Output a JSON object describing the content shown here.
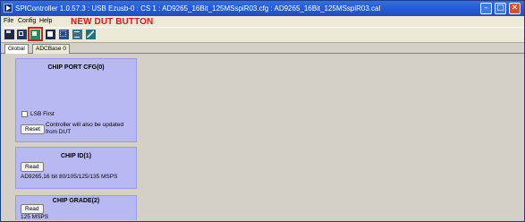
{
  "window": {
    "title": "SPIController 1.0.57.3 : USB Ezusb-0 : CS 1 : AD9265_16Bit_125MSspiR03.cfg : AD9265_16Bit_125MSspiR03.cal",
    "minimize_glyph": "–",
    "maximize_glyph": "□",
    "close_glyph": "✕"
  },
  "menu": {
    "items": [
      {
        "label": "File"
      },
      {
        "label": "Config"
      },
      {
        "label": "Help"
      }
    ]
  },
  "annotation": {
    "text": "NEW DUT BUTTON",
    "color": "#e01818"
  },
  "toolbar": {
    "icons": [
      "save-icon",
      "new-icon",
      "new-dut-icon",
      "open-icon",
      "grid-icon",
      "list-icon",
      "chart-icon"
    ]
  },
  "tabs": [
    {
      "label": "Global",
      "active": true
    },
    {
      "label": "ADCBase 0",
      "active": false
    }
  ],
  "panels": {
    "chip_port_cfg": {
      "title": "CHIP PORT CFG(0)",
      "checkbox_label": "LSB First",
      "checkbox_checked": false,
      "reset_label": "Reset",
      "note": "Controller will also be updated from DUT"
    },
    "chip_id": {
      "title": "CHIP ID(1)",
      "read_label": "Read",
      "value": "AD9265,16 bit 80/105/125/135 MSPS"
    },
    "chip_grade": {
      "title": "CHIP GRADE(2)",
      "read_label": "Read",
      "value": "125 MSPS"
    }
  },
  "colors": {
    "panel_bg": "#b8b8f2",
    "title_bar": "#245edb",
    "highlight": "#e01818"
  }
}
